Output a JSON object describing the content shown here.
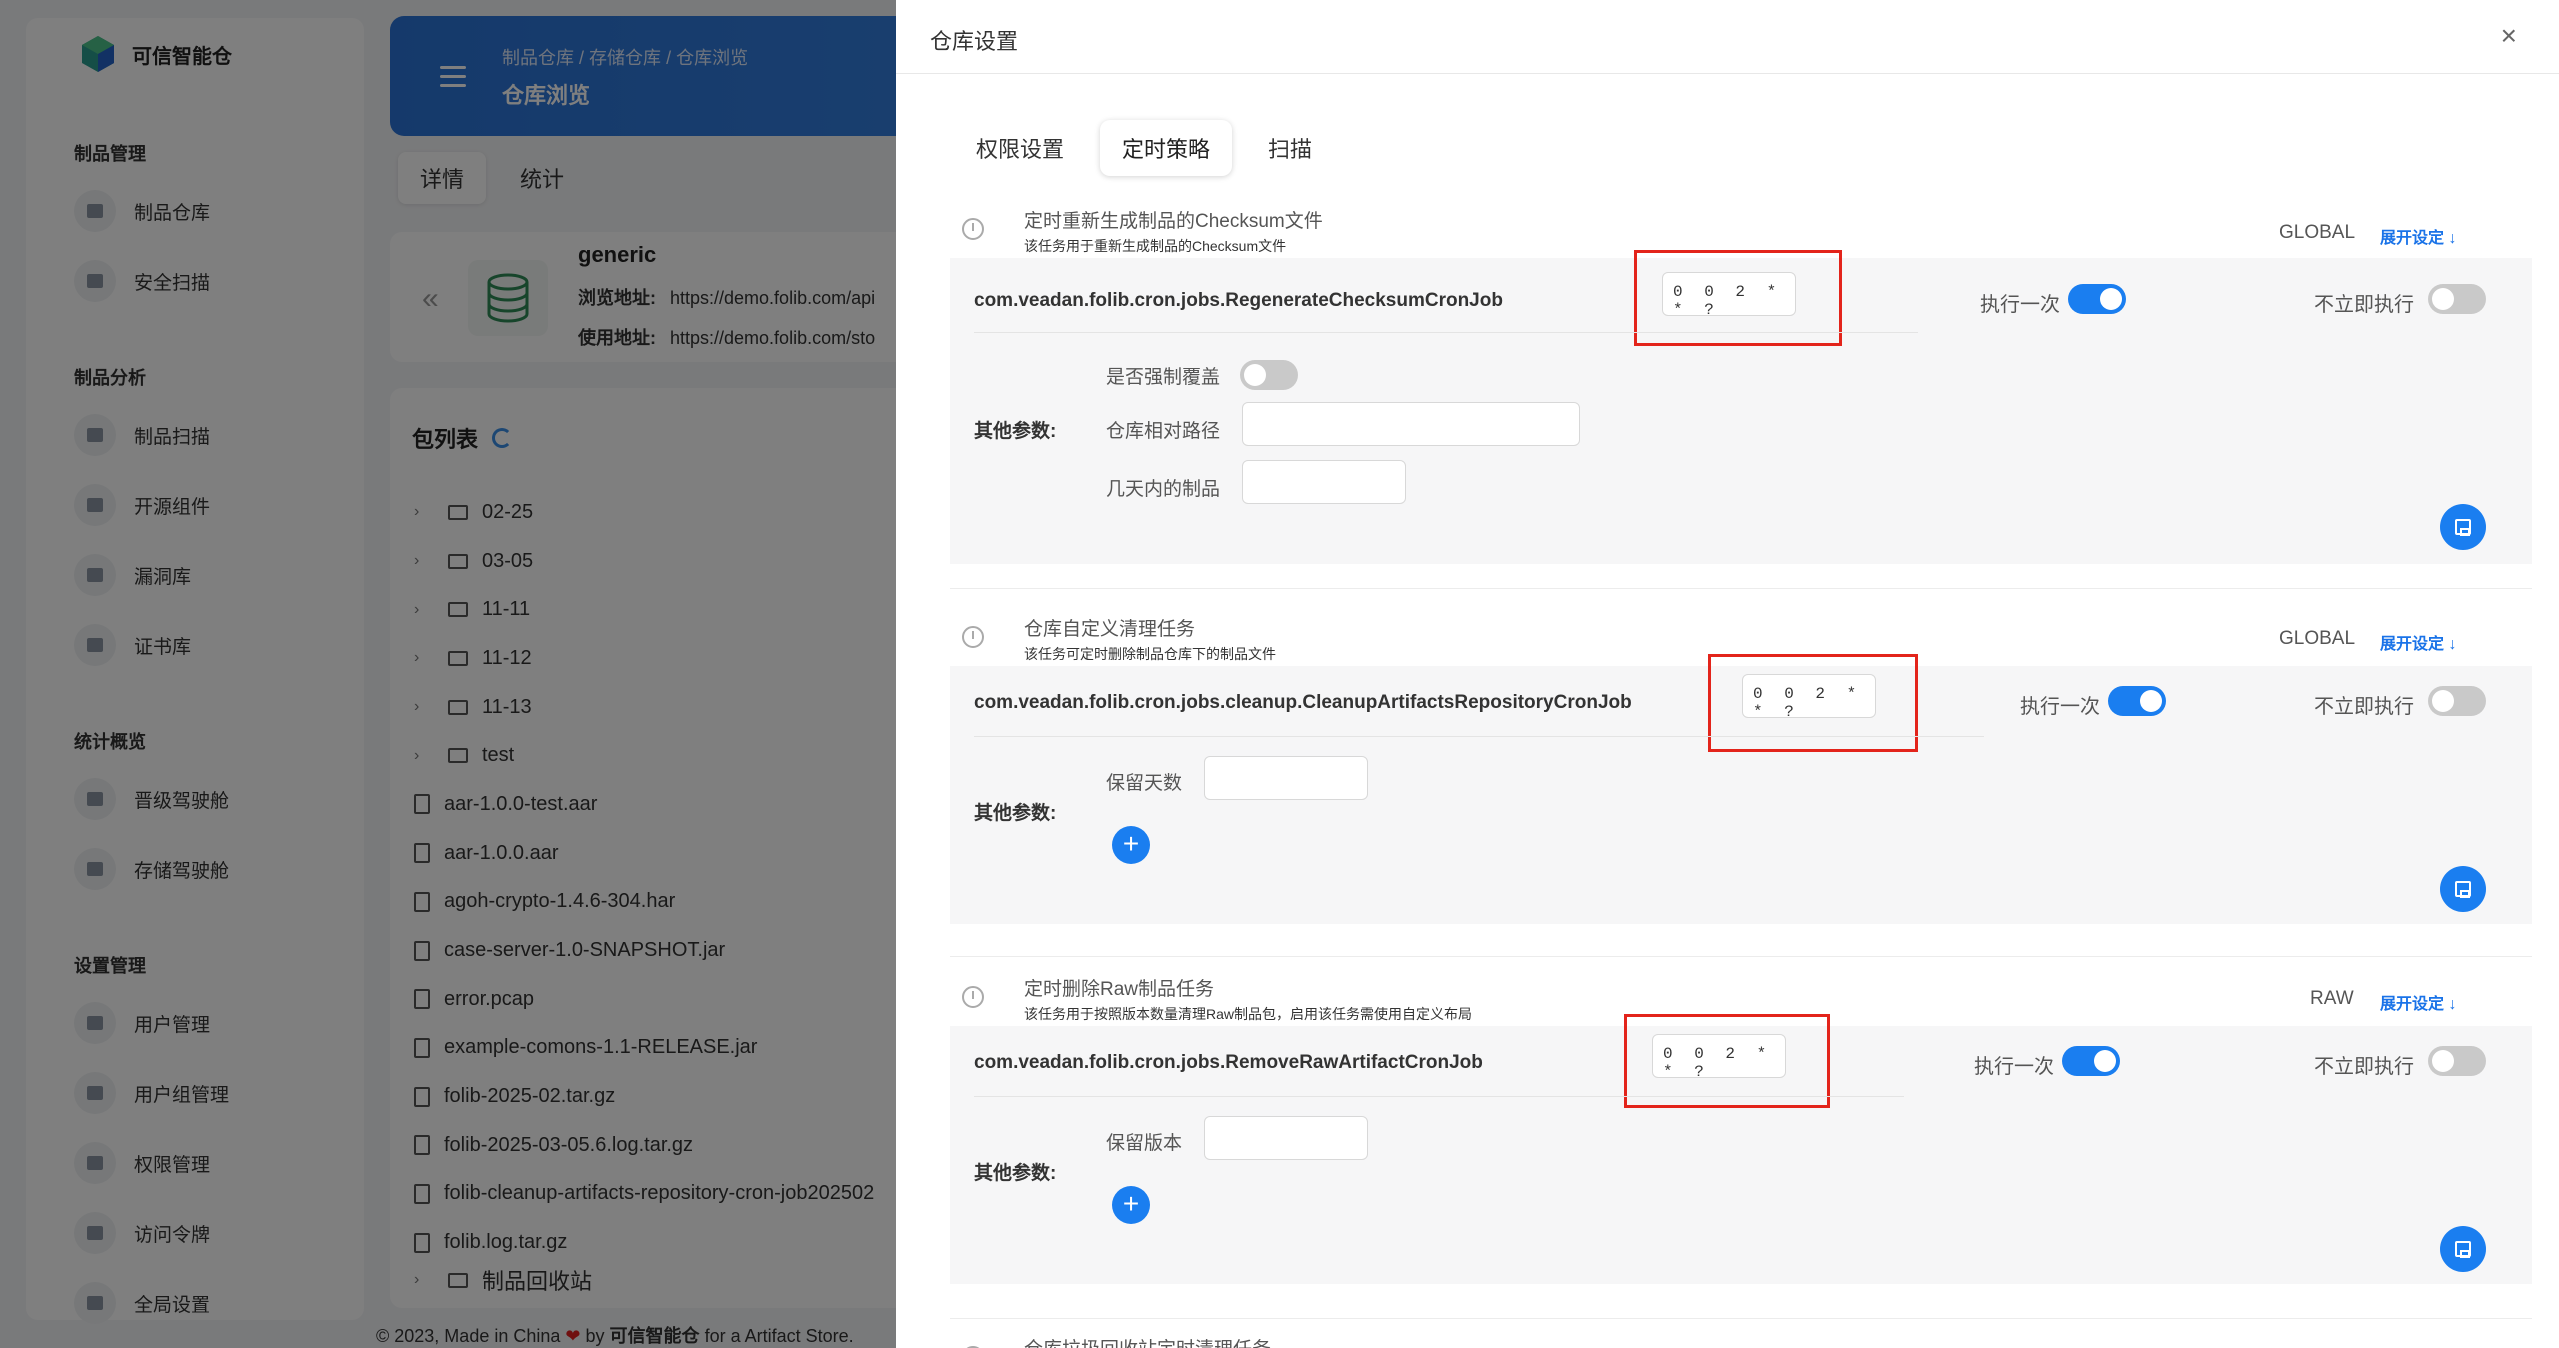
{
  "brand": {
    "name": "可信智能仓"
  },
  "sidebar": {
    "sections": [
      {
        "title": "制品管理",
        "items": [
          "制品仓库",
          "安全扫描"
        ]
      },
      {
        "title": "制品分析",
        "items": [
          "制品扫描",
          "开源组件",
          "漏洞库",
          "证书库"
        ]
      },
      {
        "title": "统计概览",
        "items": [
          "晋级驾驶舱",
          "存储驾驶舱"
        ]
      },
      {
        "title": "设置管理",
        "items": [
          "用户管理",
          "用户组管理",
          "权限管理",
          "访问令牌",
          "全局设置"
        ]
      }
    ]
  },
  "header": {
    "breadcrumb": [
      "制品仓库",
      "/",
      "存储仓库",
      "/",
      "仓库浏览"
    ],
    "title": "仓库浏览"
  },
  "main_tabs": [
    "详情",
    "统计"
  ],
  "repo": {
    "name": "generic",
    "browse_label": "浏览地址:",
    "browse_url": "https://demo.folib.com/api",
    "use_label": "使用地址:",
    "use_url": "https://demo.folib.com/sto"
  },
  "packages": {
    "title": "包列表",
    "items": [
      {
        "type": "folder",
        "name": "02-25"
      },
      {
        "type": "folder",
        "name": "03-05"
      },
      {
        "type": "folder",
        "name": "11-11"
      },
      {
        "type": "folder",
        "name": "11-12"
      },
      {
        "type": "folder",
        "name": "11-13"
      },
      {
        "type": "folder",
        "name": "test"
      },
      {
        "type": "file",
        "name": "aar-1.0.0-test.aar"
      },
      {
        "type": "file",
        "name": "aar-1.0.0.aar"
      },
      {
        "type": "file",
        "name": "agoh-crypto-1.4.6-304.har"
      },
      {
        "type": "file",
        "name": "case-server-1.0-SNAPSHOT.jar"
      },
      {
        "type": "file",
        "name": "error.pcap"
      },
      {
        "type": "file",
        "name": "example-comons-1.1-RELEASE.jar"
      },
      {
        "type": "file",
        "name": "folib-2025-02.tar.gz"
      },
      {
        "type": "file",
        "name": "folib-2025-03-05.6.log.tar.gz"
      },
      {
        "type": "file",
        "name": "folib-cleanup-artifacts-repository-cron-job202502"
      },
      {
        "type": "file",
        "name": "folib.log.tar.gz"
      }
    ],
    "recycle": "制品回收站"
  },
  "footer": {
    "prefix": "© 2023, Made in China",
    "by": "by",
    "brand": "可信智能仓",
    "suffix": "for a Artifact Store."
  },
  "drawer": {
    "title": "仓库设置",
    "close": "×",
    "tabs": [
      "权限设置",
      "定时策略",
      "扫描"
    ],
    "active_tab": 1,
    "jobs": [
      {
        "name": "定时重新生成制品的Checksum文件",
        "desc": "该任务用于重新生成制品的Checksum文件",
        "scope": "GLOBAL",
        "expand": "展开设定 ↓",
        "class": "com.veadan.folib.cron.jobs.RegenerateChecksumCronJob",
        "cron": "0 0 2 * * ?",
        "exec_once": "执行一次",
        "exec_once_on": true,
        "no_immediate": "不立即执行",
        "no_immediate_on": false,
        "other_label": "其他参数:",
        "params": [
          {
            "label": "是否强制覆盖",
            "kind": "toggle",
            "on": false
          },
          {
            "label": "仓库相对路径",
            "kind": "input",
            "value": ""
          },
          {
            "label": "几天内的制品",
            "kind": "input",
            "value": ""
          }
        ]
      },
      {
        "name": "仓库自定义清理任务",
        "desc": "该任务可定时删除制品仓库下的制品文件",
        "scope": "GLOBAL",
        "expand": "展开设定 ↓",
        "class": "com.veadan.folib.cron.jobs.cleanup.CleanupArtifactsRepositoryCronJob",
        "cron": "0 0 2 * * ?",
        "exec_once": "执行一次",
        "exec_once_on": true,
        "no_immediate": "不立即执行",
        "no_immediate_on": false,
        "other_label": "其他参数:",
        "params": [
          {
            "label": "保留天数",
            "kind": "input",
            "value": ""
          }
        ]
      },
      {
        "name": "定时删除Raw制品任务",
        "desc": "该任务用于按照版本数量清理Raw制品包，启用该任务需使用自定义布局",
        "scope": "RAW",
        "expand": "展开设定 ↓",
        "class": "com.veadan.folib.cron.jobs.RemoveRawArtifactCronJob",
        "cron": "0 0 2 * * ?",
        "exec_once": "执行一次",
        "exec_once_on": true,
        "no_immediate": "不立即执行",
        "no_immediate_on": false,
        "other_label": "其他参数:",
        "params": [
          {
            "label": "保留版本",
            "kind": "input",
            "value": ""
          }
        ]
      },
      {
        "name": "仓库垃圾回收站定时清理任务"
      }
    ]
  },
  "colors": {
    "accent": "#1a7ef0",
    "highlight": "#e3241b"
  }
}
